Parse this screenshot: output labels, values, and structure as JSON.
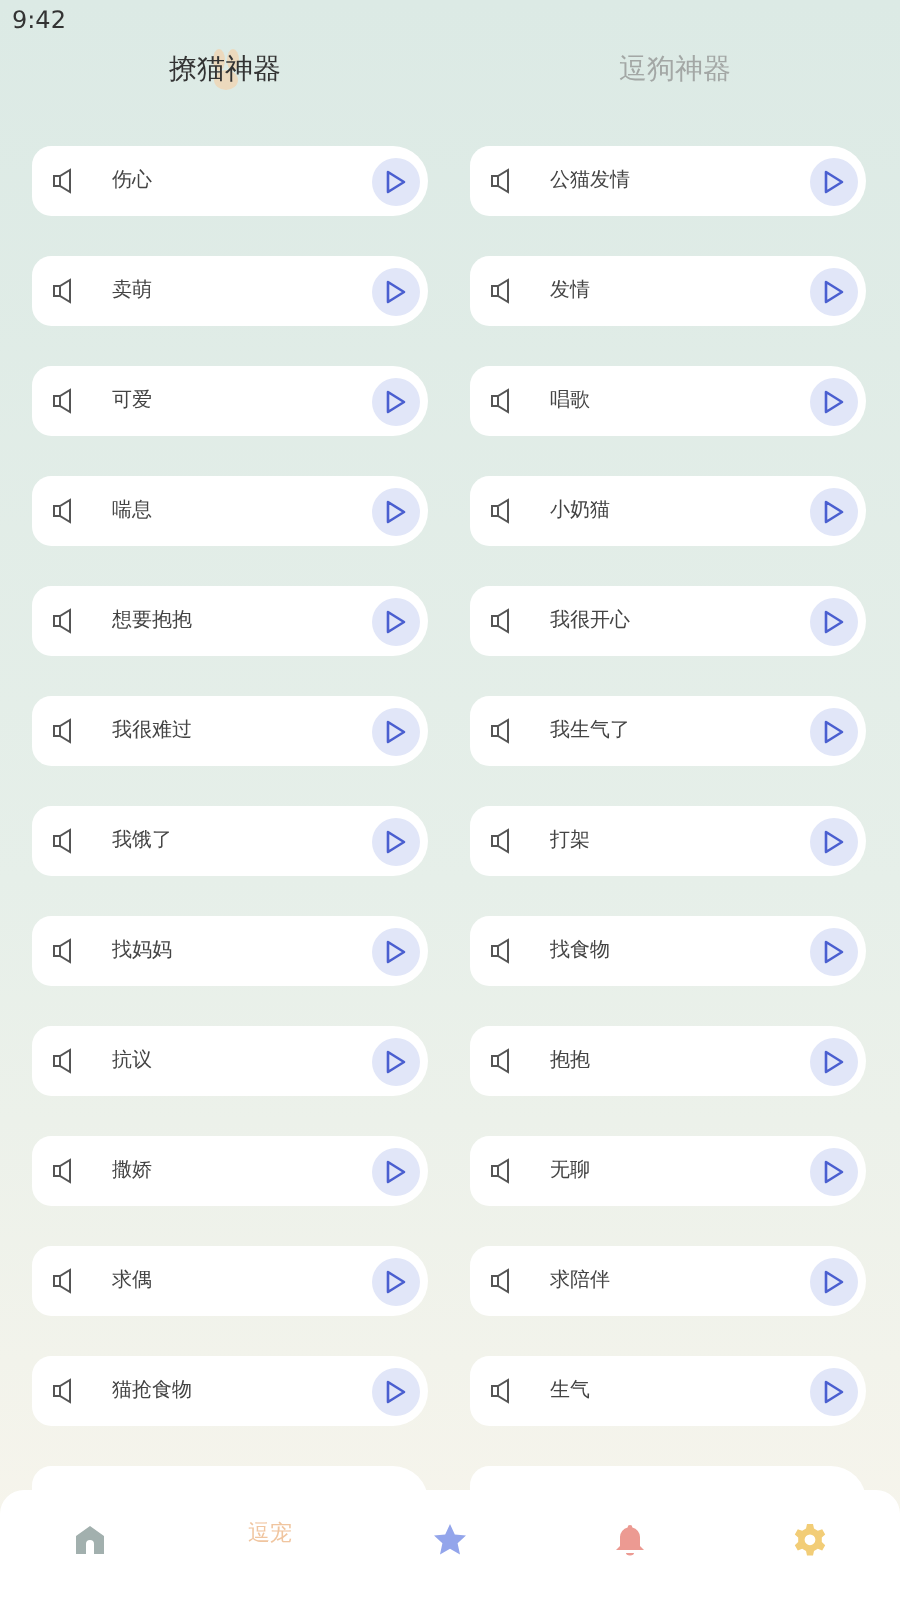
{
  "status_bar": {
    "time": "9:42"
  },
  "tabs": [
    {
      "label": "撩猫神器",
      "selected": true
    },
    {
      "label": "逗狗神器",
      "selected": false
    }
  ],
  "sounds": [
    {
      "label": "伤心"
    },
    {
      "label": "公猫发情"
    },
    {
      "label": "卖萌"
    },
    {
      "label": "发情"
    },
    {
      "label": "可爱"
    },
    {
      "label": "唱歌"
    },
    {
      "label": "喘息"
    },
    {
      "label": "小奶猫"
    },
    {
      "label": "想要抱抱"
    },
    {
      "label": "我很开心"
    },
    {
      "label": "我很难过"
    },
    {
      "label": "我生气了"
    },
    {
      "label": "我饿了"
    },
    {
      "label": "打架"
    },
    {
      "label": "找妈妈"
    },
    {
      "label": "找食物"
    },
    {
      "label": "抗议"
    },
    {
      "label": "抱抱"
    },
    {
      "label": "撒娇"
    },
    {
      "label": "无聊"
    },
    {
      "label": "求偶"
    },
    {
      "label": "求陪伴"
    },
    {
      "label": "猫抢食物"
    },
    {
      "label": "生气"
    }
  ],
  "bottom_nav": [
    {
      "kind": "home"
    },
    {
      "kind": "text",
      "label": "逗宠"
    },
    {
      "kind": "star"
    },
    {
      "kind": "bell"
    },
    {
      "kind": "gear"
    }
  ]
}
